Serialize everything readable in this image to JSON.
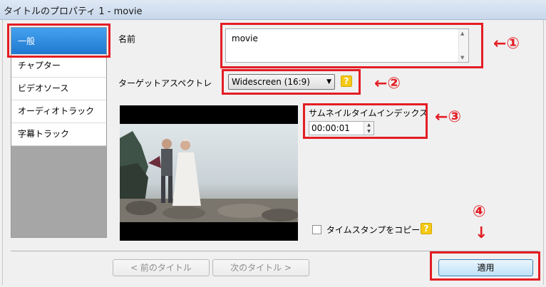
{
  "window": {
    "title": "タイトルのプロパティ 1 - movie"
  },
  "sidebar": {
    "items": [
      {
        "label": "一般",
        "active": true
      },
      {
        "label": "チャプター"
      },
      {
        "label": "ビデオソース"
      },
      {
        "label": "オーディオトラック"
      },
      {
        "label": "字幕トラック"
      }
    ]
  },
  "form": {
    "name_label": "名前",
    "name_value": "movie",
    "aspect_label": "ターゲットアスペクトレ",
    "aspect_value": "Widescreen (16:9)",
    "help_glyph": "?",
    "thumb_label": "サムネイルタイムインデックス",
    "thumb_value": "00:00:01",
    "copy_timestamp_label": "タイムスタンプをコピー"
  },
  "buttons": {
    "prev": "< 前のタイトル",
    "next": "次のタイトル >",
    "apply": "適用"
  },
  "annotations": {
    "a1": "←①",
    "a2": "←②",
    "a3": "←③",
    "a4": "④",
    "a4_arrow": "↓"
  },
  "colors": {
    "accent": "#e31e24",
    "selection": "#2a86db",
    "help": "#f5c915"
  }
}
